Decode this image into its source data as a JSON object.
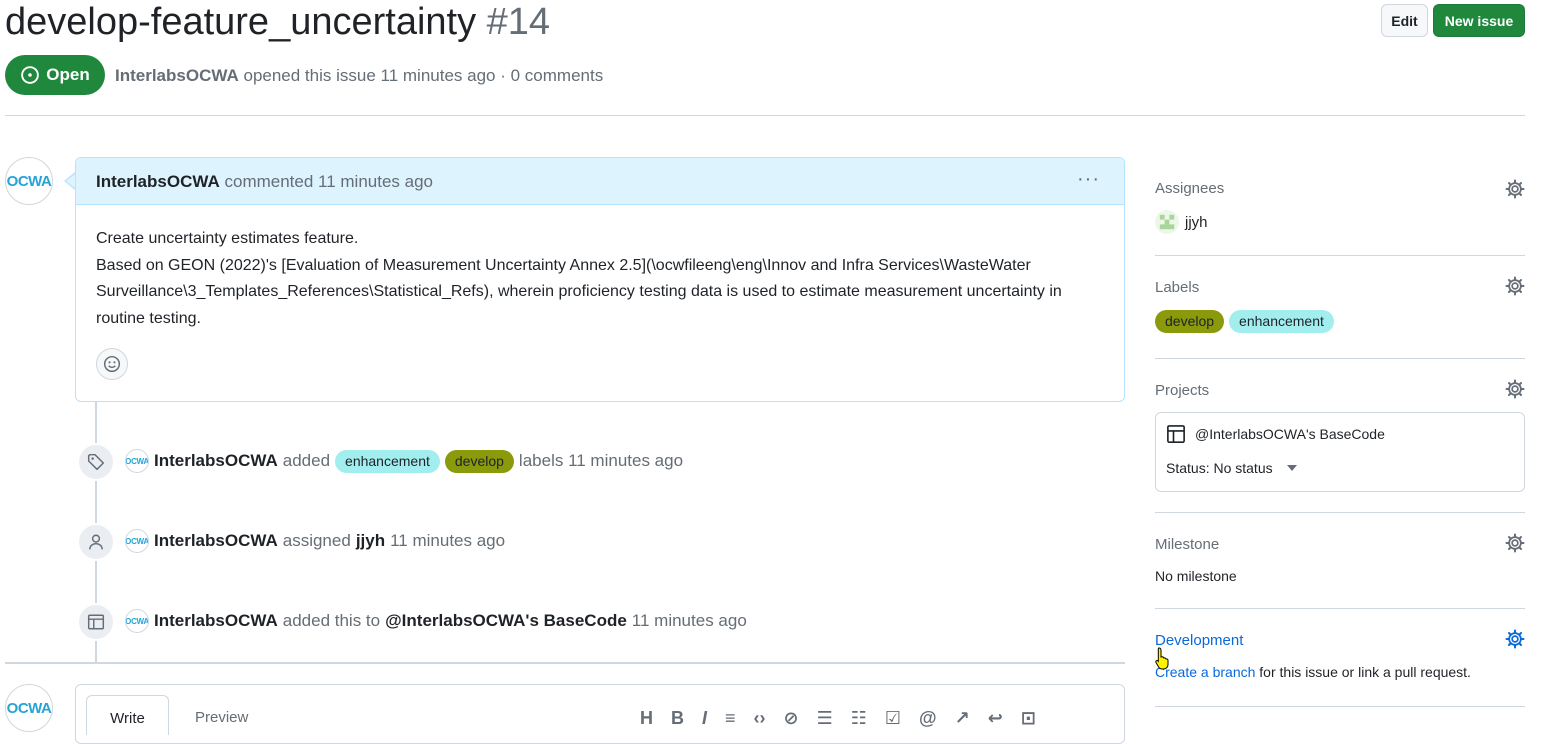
{
  "issue": {
    "title": "develop-feature_uncertainty",
    "number": "#14",
    "state": "Open",
    "author": "InterlabsOCWA",
    "meta_rest": "opened this issue 11 minutes ago · 0 comments"
  },
  "header_buttons": {
    "edit": "Edit",
    "new_issue": "New issue"
  },
  "comment": {
    "author": "InterlabsOCWA",
    "action": "commented 11 minutes ago",
    "menu": "···",
    "lines": [
      "Create uncertainty estimates feature.",
      "Based on GEON (2022)'s [Evaluation of Measurement Uncertainty Annex 2.5](\\ocwfileeng\\eng\\Innov and Infra Services\\WasteWater Surveillance\\3_Templates_References\\Statistical_Refs), wherein proficiency testing data is used to estimate measurement uncertainty in routine testing."
    ]
  },
  "avatar_text": "OCWA",
  "timeline": {
    "labels_event": {
      "actor": "InterlabsOCWA",
      "verb": "added",
      "label1": "enhancement",
      "label2": "develop",
      "suffix": "labels 11 minutes ago"
    },
    "assign_event": {
      "actor": "InterlabsOCWA",
      "verb": "assigned",
      "assignee": "jjyh",
      "suffix": "11 minutes ago"
    },
    "project_event": {
      "actor": "InterlabsOCWA",
      "verb": "added this to",
      "project": "@InterlabsOCWA's BaseCode",
      "suffix": "11 minutes ago"
    }
  },
  "editor": {
    "write_tab": "Write",
    "preview_tab": "Preview"
  },
  "sidebar": {
    "assignees": {
      "heading": "Assignees",
      "user": "jjyh"
    },
    "labels": {
      "heading": "Labels",
      "items": [
        "develop",
        "enhancement"
      ]
    },
    "projects": {
      "heading": "Projects",
      "project_name": "@InterlabsOCWA's BaseCode",
      "status": "Status: No status"
    },
    "milestone": {
      "heading": "Milestone",
      "value": "No milestone"
    },
    "development": {
      "heading": "Development",
      "link": "Create a branch",
      "rest": "for this issue or link a pull request."
    }
  },
  "colors": {
    "green": "#1f883d",
    "blue": "#0969da",
    "label_enhancement": "#a2eeef",
    "label_develop": "#8a9a0b"
  }
}
